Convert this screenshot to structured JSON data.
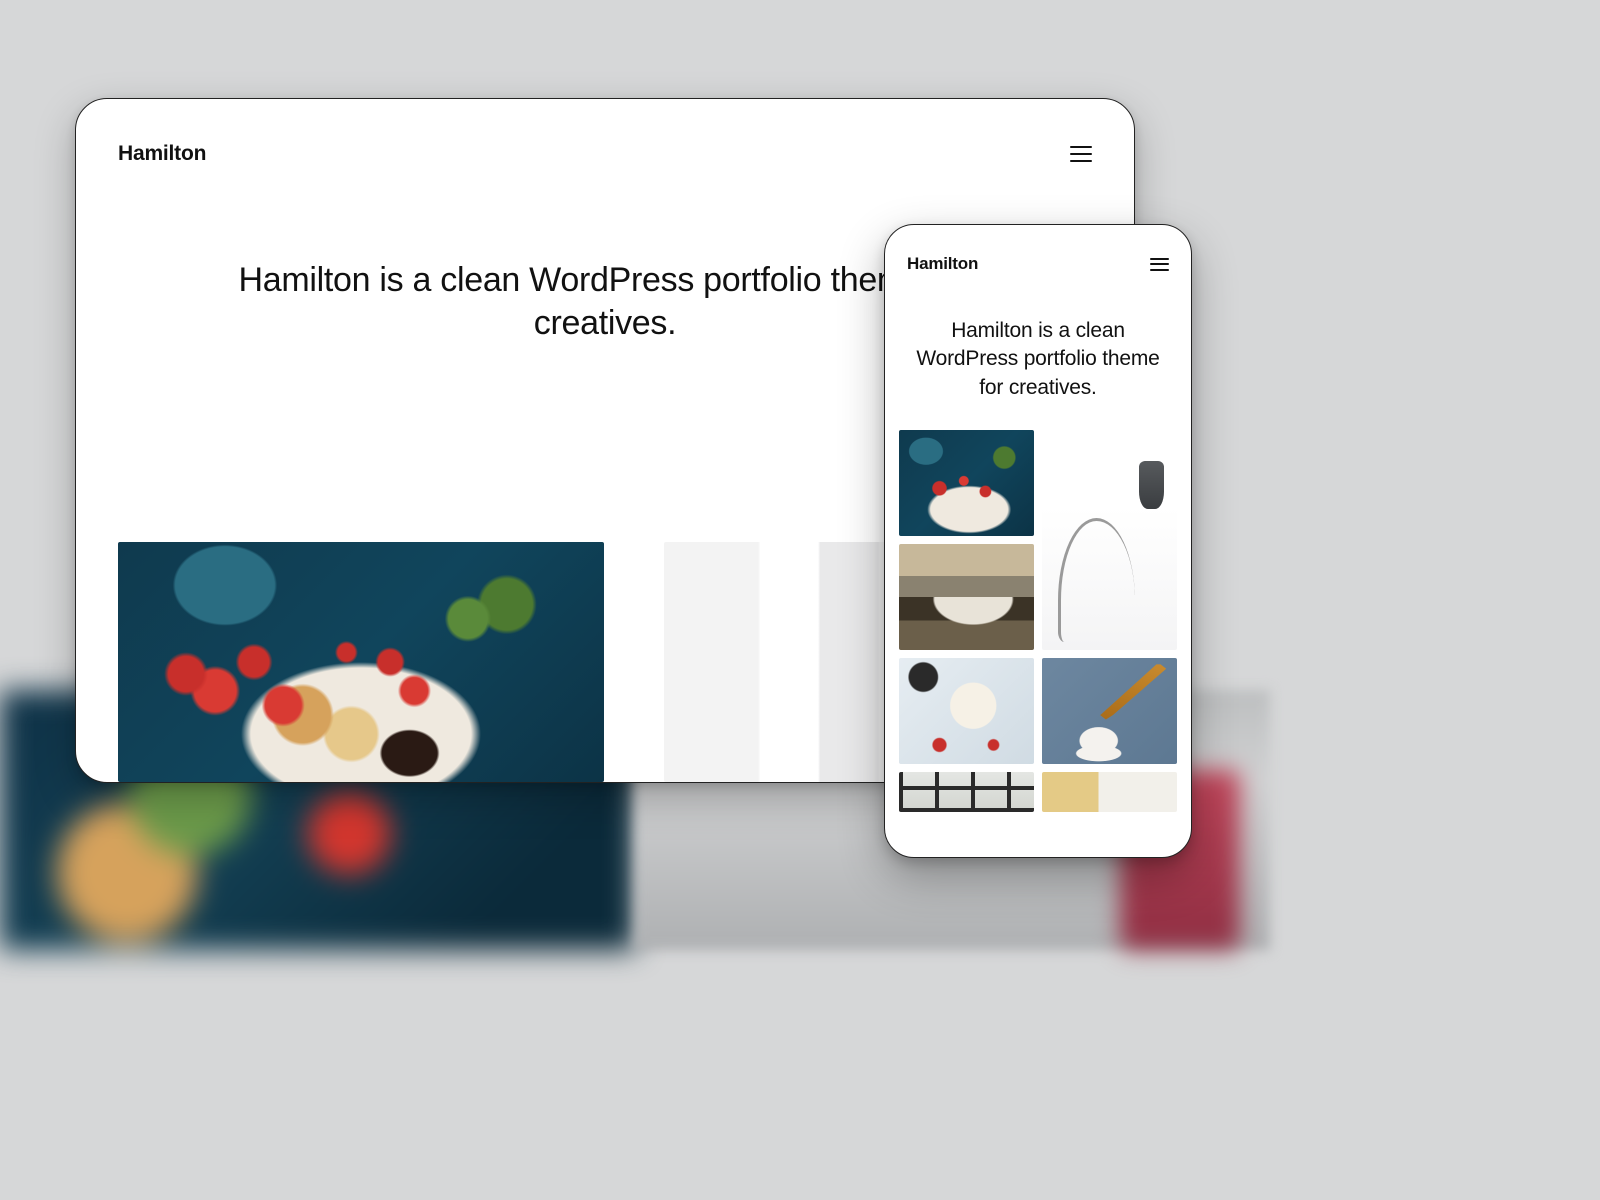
{
  "desktop": {
    "brand": "Hamilton",
    "tagline": "Hamilton is a clean WordPress portfolio theme for creatives.",
    "menu_icon": "hamburger-icon"
  },
  "mobile": {
    "brand": "Hamilton",
    "tagline": "Hamilton is a clean WordPress portfolio theme for creatives.",
    "menu_icon": "hamburger-icon"
  },
  "thumbnails": {
    "food_platter": "food-platter",
    "white_interior": "white-interior-chair",
    "mountain": "mountain-landscape",
    "breakfast": "breakfast-bowl",
    "honey": "honey-dipper",
    "window": "window-grid",
    "peek": "partial-image"
  }
}
